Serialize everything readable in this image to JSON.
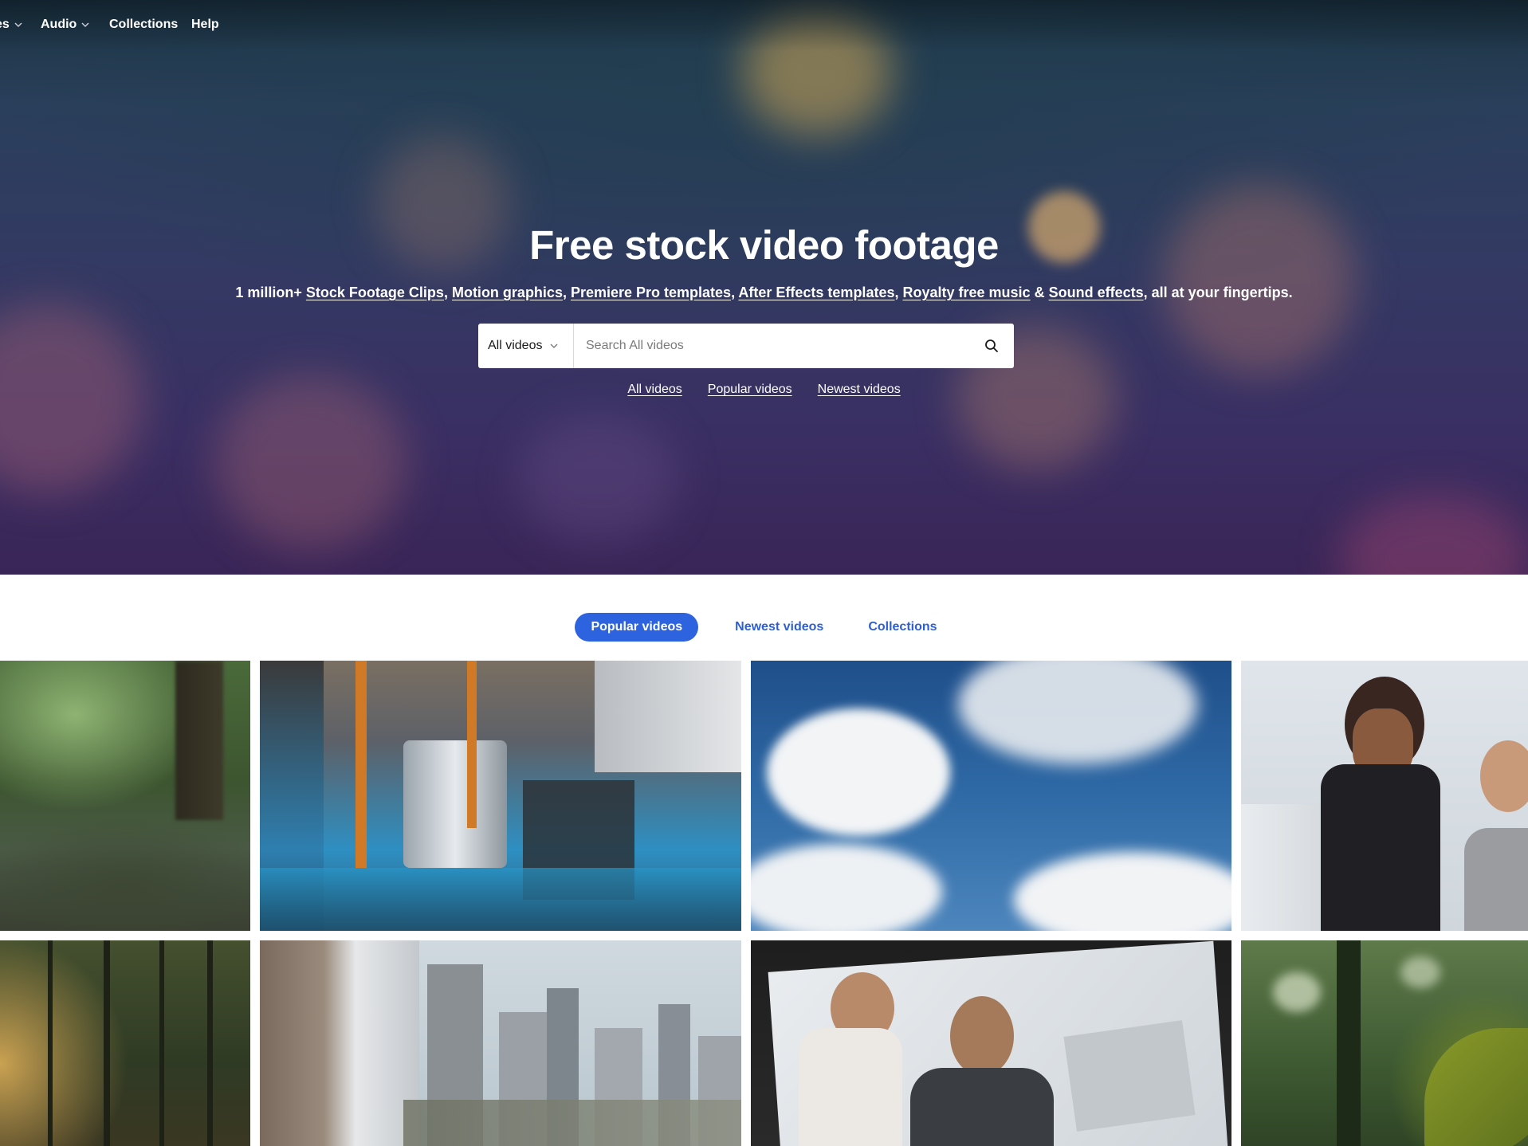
{
  "nav": {
    "items": [
      {
        "label": "es",
        "has_dropdown": true
      },
      {
        "label": "Audio",
        "has_dropdown": true
      },
      {
        "label": "Collections",
        "has_dropdown": false
      },
      {
        "label": "Help",
        "has_dropdown": false
      }
    ]
  },
  "hero": {
    "title": "Free stock video footage",
    "subtitle": {
      "prefix": "1 million+ ",
      "link_stock": "Stock Footage Clips",
      "link_motion": "Motion graphics",
      "link_premiere": "Premiere Pro templates",
      "link_ae": "After Effects templates",
      "link_music": "Royalty free music",
      "amp": " & ",
      "link_sfx": "Sound effects",
      "suffix": ", all at your fingertips."
    }
  },
  "search": {
    "category": "All videos",
    "placeholder": "Search All videos",
    "value": ""
  },
  "quicklinks": [
    "All videos",
    "Popular videos",
    "Newest videos"
  ],
  "tabs": [
    {
      "label": "Popular videos",
      "active": true
    },
    {
      "label": "Newest videos",
      "active": false
    },
    {
      "label": "Collections",
      "active": false
    }
  ],
  "colors": {
    "accent": "#2e63e0",
    "tab_text": "#2f5fd0"
  }
}
